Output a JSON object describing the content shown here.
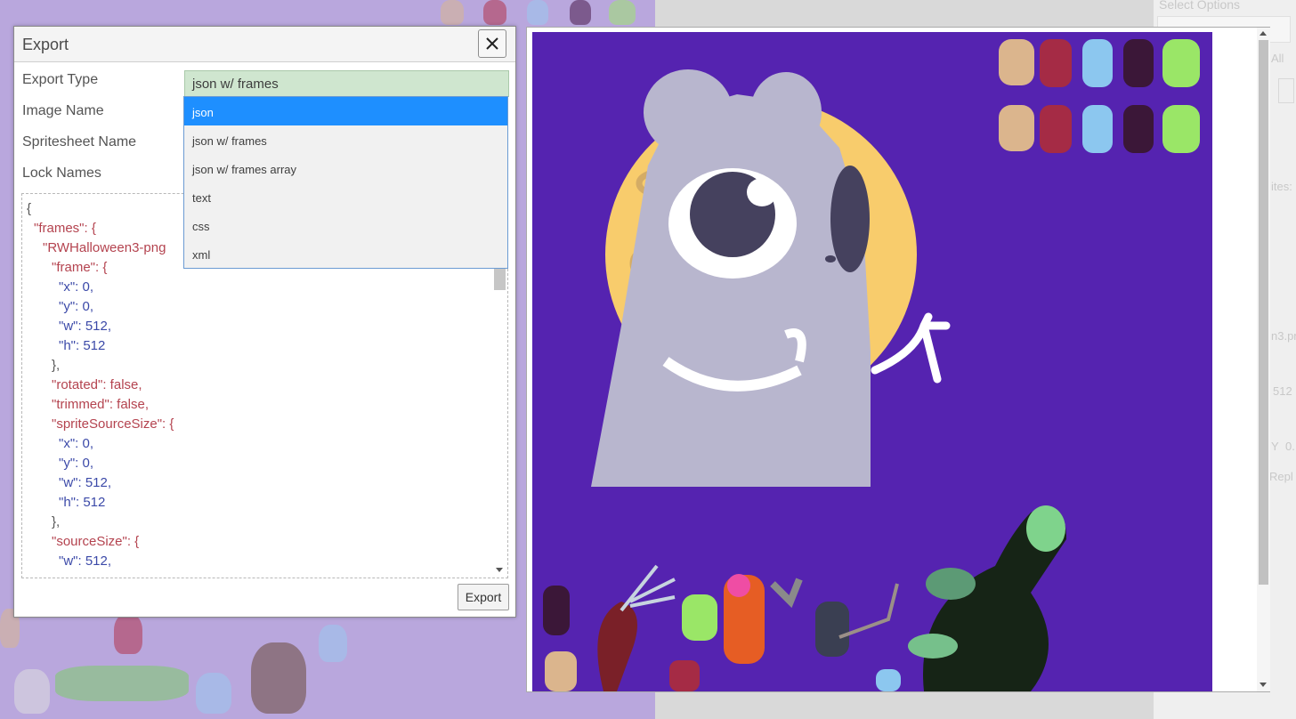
{
  "dialog": {
    "title": "Export",
    "close_icon": "close-icon",
    "labels": {
      "export_type": "Export Type",
      "image_name": "Image Name",
      "spritesheet_name": "Spritesheet Name",
      "lock_names": "Lock Names"
    },
    "export_type_value": "json w/ frames",
    "export_button": "Export"
  },
  "dropdown": {
    "options": [
      "json",
      "json w/ frames",
      "json w/ frames array",
      "text",
      "css",
      "xml"
    ],
    "selected_index": 0
  },
  "code": {
    "lines": [
      "{",
      "\"frames\": {",
      "\"RWHalloween3-png",
      "\"frame\": {",
      "\"x\": 0,",
      "\"y\": 0,",
      "\"w\": 512,",
      "\"h\": 512",
      "},",
      "\"rotated\": false,",
      "\"trimmed\": false,",
      "\"spriteSourceSize\": {",
      "\"x\": 0,",
      "\"y\": 0,",
      "\"w\": 512,",
      "\"h\": 512",
      "},",
      "\"sourceSize\": {",
      "\"w\": 512,"
    ]
  },
  "background_panel": {
    "select_options_text": "Select Options",
    "all_text": "All",
    "sprites_text": "ites:",
    "filename_text": "n3.pn",
    "size_text": "512",
    "y_label": "Y",
    "y_value": "0.",
    "replace_text": "Repl"
  },
  "colors": {
    "canvas_bg": "#5523b0",
    "dropdown_selected": "#1e8fff",
    "select_bg": "#cfe6cf",
    "purple_page": "#b9a7dd"
  }
}
